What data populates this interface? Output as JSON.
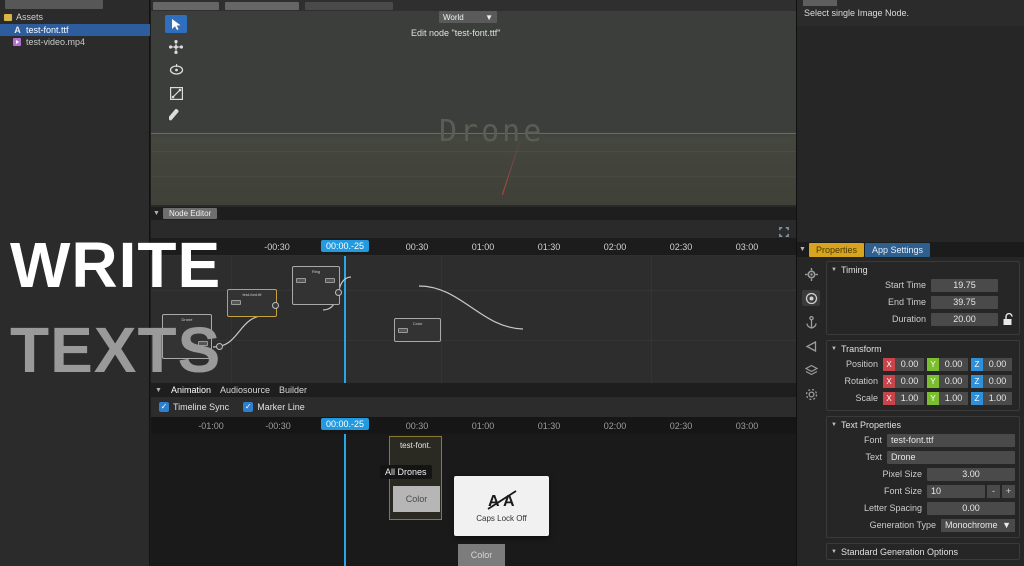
{
  "assets": {
    "search_placeholder": "",
    "root_label": "Assets",
    "items": [
      {
        "name": "test-font.ttf",
        "icon": "font-file-icon",
        "selected": true
      },
      {
        "name": "test-video.mp4",
        "icon": "video-file-icon",
        "selected": false
      }
    ]
  },
  "viewport": {
    "space_dropdown": "World",
    "edit_node_label": "Edit node \"test-font.ttf\"",
    "scene_text": "Drone",
    "tools": [
      {
        "name": "select-tool",
        "glyph": "➤",
        "selected": true
      },
      {
        "name": "move-tool",
        "glyph": "✥",
        "selected": false
      },
      {
        "name": "rotate-tool",
        "glyph": "◌",
        "selected": false
      },
      {
        "name": "scale-tool",
        "glyph": "⤡",
        "selected": false
      },
      {
        "name": "paint-tool",
        "glyph": "✎",
        "selected": false
      }
    ],
    "gizmo": {
      "x_color": "#d8473f",
      "y_color": "#6fbd25",
      "z_color": "#2f7fd8"
    }
  },
  "node_editor": {
    "panel_title": "Node Editor",
    "ruler_ticks": [
      "-01:00",
      "-00:30",
      "00:30",
      "01:00",
      "01:30",
      "02:00",
      "02:30",
      "03:00"
    ],
    "playhead_label": "00:00.-25",
    "nodes": [
      {
        "title": "Drone",
        "selected": false
      },
      {
        "title": "test-font.ttf",
        "selected": true
      },
      {
        "title": "Ring",
        "selected": false
      },
      {
        "title": "Color",
        "selected": false
      }
    ]
  },
  "animation": {
    "tabs": [
      {
        "label": "Animation",
        "active": true
      },
      {
        "label": "Audiosource",
        "active": false
      },
      {
        "label": "Builder",
        "active": false
      }
    ],
    "checkboxes": [
      {
        "label": "Timeline Sync",
        "checked": true
      },
      {
        "label": "Marker Line",
        "checked": true
      }
    ],
    "ruler_ticks": [
      "-01:00",
      "-00:30",
      "00:30",
      "01:00",
      "01:30",
      "02:00",
      "02:30",
      "03:00"
    ],
    "playhead_label": "00:00.-25",
    "clip": {
      "title": "test-font.",
      "tooltip": "All Drones",
      "color_label": "Color"
    },
    "secondary_color_label": "Color",
    "capslock_popup": {
      "label": "Caps Lock Off",
      "icon": "caps-lock-off-icon"
    }
  },
  "overlay": {
    "line1": "WRITE",
    "line2": "TEXTS"
  },
  "properties": {
    "hint_text": "Select single Image Node.",
    "tabs": [
      {
        "label": "Properties",
        "active": true
      },
      {
        "label": "App Settings",
        "active": false
      }
    ],
    "timing": {
      "title": "Timing",
      "start_time_label": "Start Time",
      "start_time_value": "19.75",
      "end_time_label": "End Time",
      "end_time_value": "39.75",
      "duration_label": "Duration",
      "duration_value": "20.00",
      "lock_icon": "unlock-icon"
    },
    "transform": {
      "title": "Transform",
      "rows": [
        {
          "label": "Position",
          "x": "0.00",
          "y": "0.00",
          "z": "0.00"
        },
        {
          "label": "Rotation",
          "x": "0.00",
          "y": "0.00",
          "z": "0.00"
        },
        {
          "label": "Scale",
          "x": "1.00",
          "y": "1.00",
          "z": "1.00"
        }
      ],
      "axis_x": "X",
      "axis_y": "Y",
      "axis_z": "Z"
    },
    "text_properties": {
      "title": "Text Properties",
      "font_label": "Font",
      "font_value": "test-font.ttf",
      "text_label": "Text",
      "text_value": "Drone",
      "pixel_size_label": "Pixel Size",
      "pixel_size_value": "3.00",
      "font_size_label": "Font Size",
      "font_size_value": "10",
      "font_size_minus": "-",
      "font_size_plus": "+",
      "letter_spacing_label": "Letter Spacing",
      "letter_spacing_value": "0.00",
      "generation_type_label": "Generation Type",
      "generation_type_value": "Monochrome"
    },
    "standard_options_title": "Standard Generation Options",
    "side_icons": [
      {
        "name": "gear-icon",
        "glyph": "⚙",
        "selected": false
      },
      {
        "name": "sphere-icon",
        "glyph": "◉",
        "selected": true
      },
      {
        "name": "anchor-icon",
        "glyph": "⚓",
        "selected": false
      },
      {
        "name": "share-icon",
        "glyph": "◁",
        "selected": false
      },
      {
        "name": "layers-icon",
        "glyph": "☰",
        "selected": false
      },
      {
        "name": "settings-icon",
        "glyph": "☸",
        "selected": false
      }
    ]
  },
  "colors": {
    "accent_blue": "#239adf",
    "accent_gold": "#d8a41f",
    "selection_blue": "#2e5d9e"
  }
}
